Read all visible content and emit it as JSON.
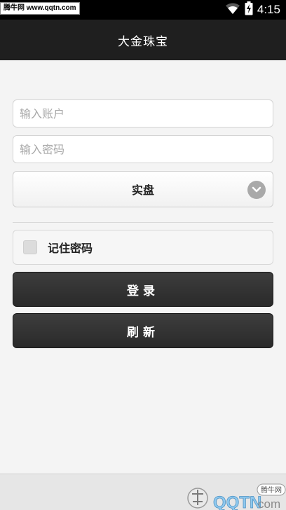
{
  "status_bar": {
    "watermark_text": "腾牛网 www.qqtn.com",
    "time": "4:15",
    "icons": [
      "wifi-icon",
      "battery-charging-icon"
    ]
  },
  "app_bar": {
    "title": "大金珠宝"
  },
  "login_form": {
    "account_placeholder": "输入账户",
    "account_value": "",
    "password_placeholder": "输入密码",
    "password_value": "",
    "account_type_selected": "实盘",
    "remember_label": "记住密码",
    "remember_checked": false,
    "login_label": "登录",
    "refresh_label": "刷新"
  },
  "watermark_logo": {
    "brand_text": "QQTN",
    "suffix_text": "com",
    "tag_text": "腾牛网"
  },
  "colors": {
    "status_bar": "#000000",
    "app_bar": "#1f1f1f",
    "background": "#f4f4f4",
    "button": "#333333",
    "button_text": "#ffffff"
  }
}
